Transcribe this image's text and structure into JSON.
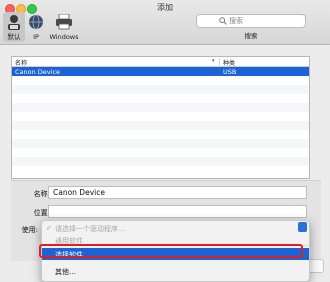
{
  "window": {
    "title": "添加"
  },
  "toolbar": {
    "default_label": "默认",
    "ip_label": "IP",
    "windows_label": "Windows",
    "search_placeholder": "搜索",
    "search_label": "搜索"
  },
  "printer_list": {
    "columns": {
      "name": "名称",
      "kind": "种类"
    },
    "rows": [
      {
        "name": "Canon Device",
        "kind": "USB",
        "selected": true
      }
    ]
  },
  "form": {
    "name_label": "名称:",
    "name_value": "Canon Device",
    "location_label": "位置:",
    "location_value": "",
    "use_label": "使用:"
  },
  "use_menu": {
    "items": [
      {
        "label": "请选择一个驱动程序…",
        "checked": true,
        "enabled": false
      },
      {
        "label": "通用软件",
        "checked": false,
        "enabled": false
      },
      {
        "label": "选择软件…",
        "checked": false,
        "enabled": true,
        "highlighted": true
      },
      {
        "label": "其他…",
        "checked": false,
        "enabled": true
      }
    ]
  },
  "colors": {
    "selection": "#1b63d6",
    "highlight_outline": "#e02020"
  }
}
